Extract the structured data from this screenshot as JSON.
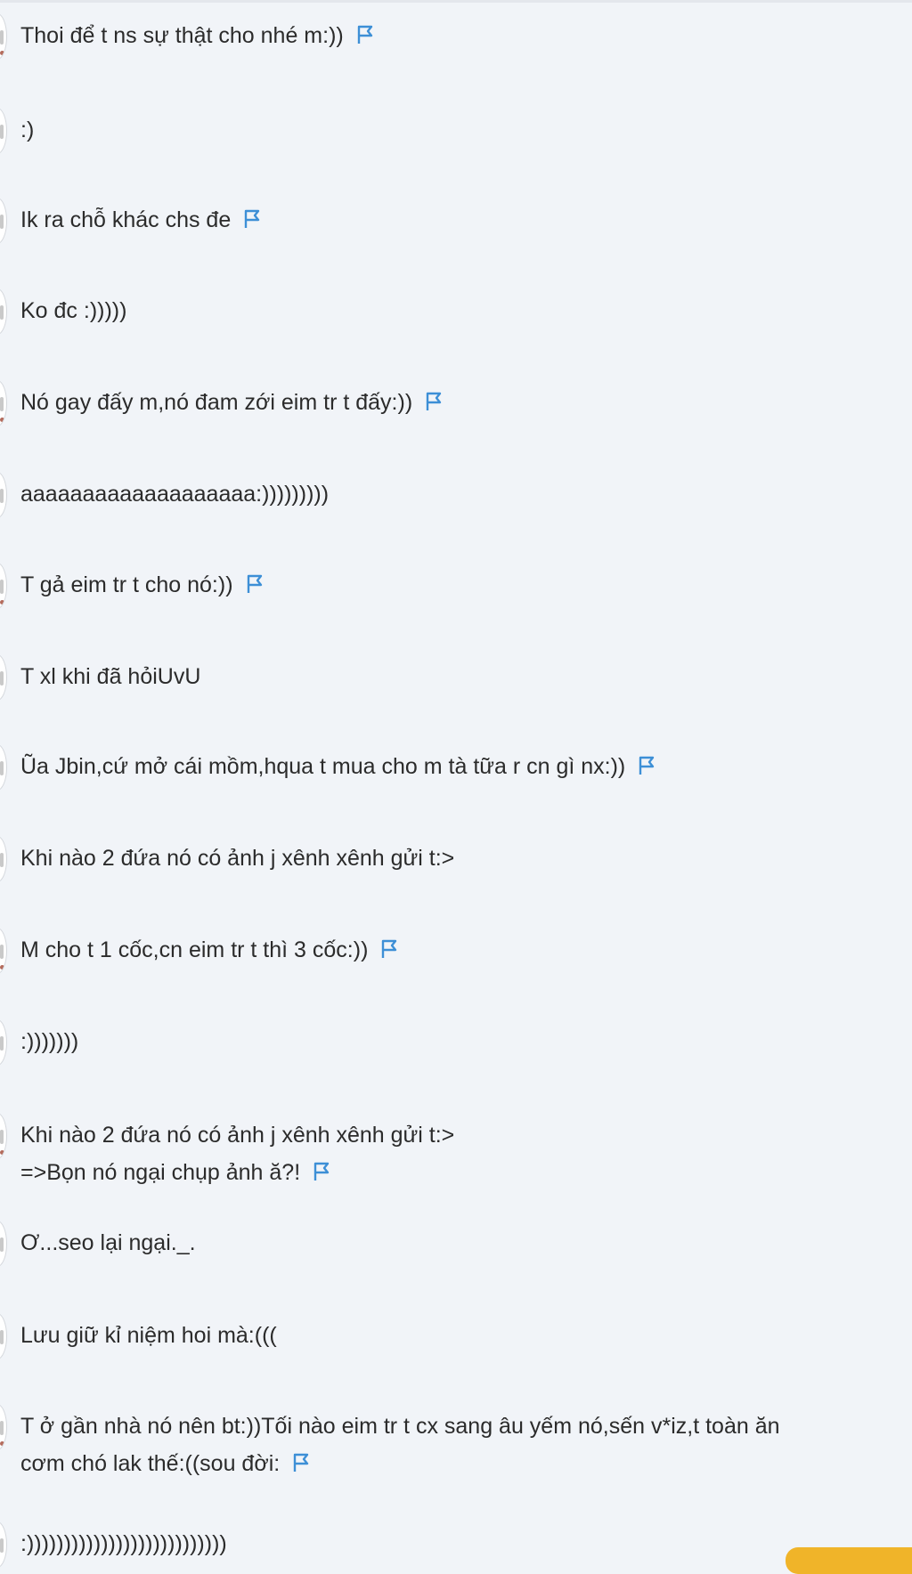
{
  "colors": {
    "background": "#f1f4f8",
    "text": "#2b2b2b",
    "flag": "#3d8fd6",
    "badge": "#f0b429"
  },
  "icons": {
    "flag": "flag-icon",
    "avatar": "avatar"
  },
  "messages": [
    {
      "lines": [
        "Thoi để t ns sự thật cho nhé m:))"
      ],
      "flag": true
    },
    {
      "lines": [
        ":)"
      ],
      "flag": false
    },
    {
      "lines": [
        "Ik ra chỗ khác chs đe"
      ],
      "flag": true
    },
    {
      "lines": [
        "Ko đc :)))))"
      ],
      "flag": false
    },
    {
      "lines": [
        "Nó gay đấy m,nó đam zới eim tr t đấy:))"
      ],
      "flag": true
    },
    {
      "lines": [
        "aaaaaaaaaaaaaaaaaaa:)))))))))"
      ],
      "flag": false
    },
    {
      "lines": [
        "T gả eim tr t cho nó:))"
      ],
      "flag": true
    },
    {
      "lines": [
        "T xl khi đã hỏiUvU"
      ],
      "flag": false
    },
    {
      "lines": [
        "Ũa Jbin,cứ mở cái mồm,hqua t mua cho m tà tữa r cn gì nx:))"
      ],
      "flag": true
    },
    {
      "lines": [
        "Khi nào 2 đứa nó có ảnh j xênh xênh gửi t:>"
      ],
      "flag": false
    },
    {
      "lines": [
        "M cho t 1 cốc,cn eim tr t thì 3 cốc:))"
      ],
      "flag": true
    },
    {
      "lines": [
        ":)))))))"
      ],
      "flag": false
    },
    {
      "lines": [
        "Khi nào 2 đứa nó có ảnh j xênh xênh gửi t:>",
        "=>Bọn nó ngại chụp ảnh ă?!"
      ],
      "flag": true
    },
    {
      "lines": [
        "Ơ...seo lại ngại._."
      ],
      "flag": false
    },
    {
      "lines": [
        "Lưu giữ kỉ niệm hoi mà:((("
      ],
      "flag": false
    },
    {
      "lines": [
        "T ở gần nhà nó nên bt:))Tối nào eim tr t cx sang âu yếm nó,sến v*iz,t toàn ăn",
        "cơm chó lak thế:((sou đời:"
      ],
      "flag": true
    },
    {
      "lines": [
        ":)))))))))))))))))))))))))))"
      ],
      "flag": false
    }
  ]
}
